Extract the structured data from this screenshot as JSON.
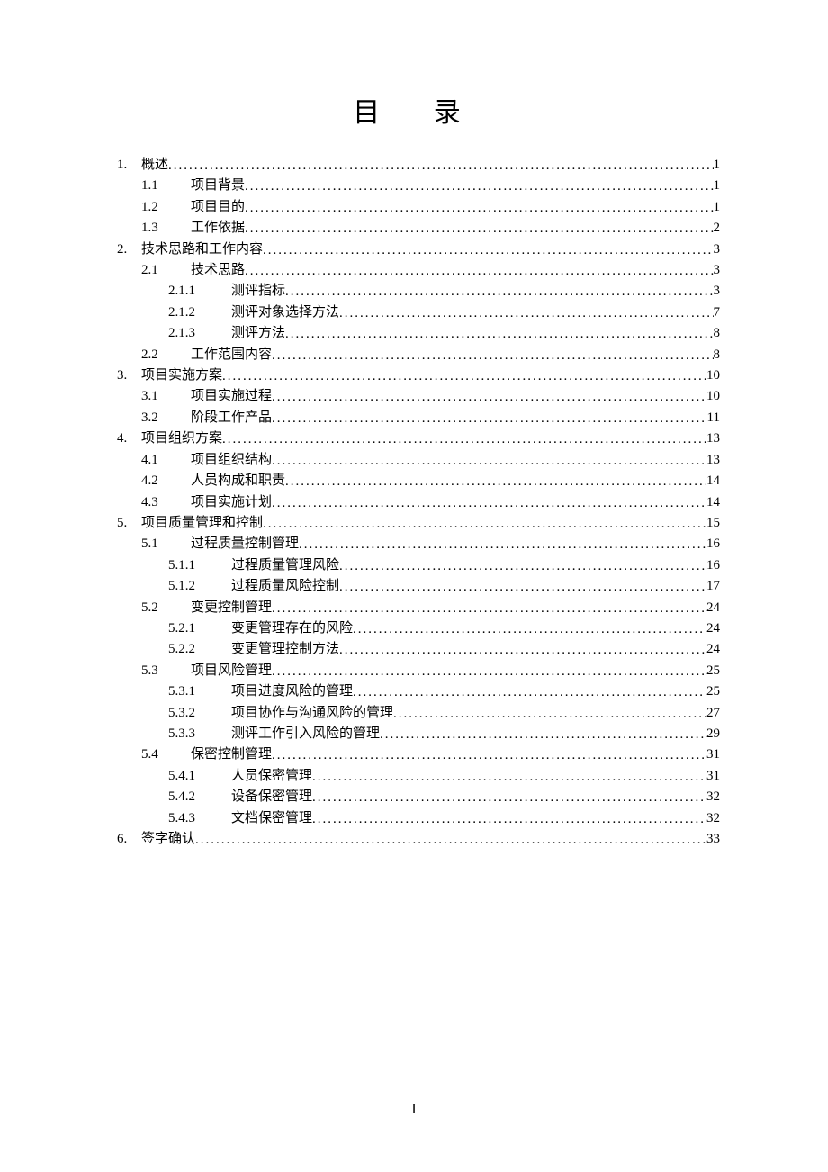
{
  "title": "目 录",
  "page_footer": "I",
  "toc": [
    {
      "level": 1,
      "num": "1.",
      "title": "概述",
      "page": "1"
    },
    {
      "level": 2,
      "num": "1.1",
      "title": "项目背景",
      "page": "1"
    },
    {
      "level": 2,
      "num": "1.2",
      "title": "项目目的",
      "page": "1"
    },
    {
      "level": 2,
      "num": "1.3",
      "title": "工作依据",
      "page": "2"
    },
    {
      "level": 1,
      "num": "2.",
      "title": "技术思路和工作内容",
      "page": "3"
    },
    {
      "level": 2,
      "num": "2.1",
      "title": "技术思路",
      "page": "3"
    },
    {
      "level": 3,
      "num": "2.1.1",
      "title": "测评指标",
      "page": "3"
    },
    {
      "level": 3,
      "num": "2.1.2",
      "title": "测评对象选择方法",
      "page": "7"
    },
    {
      "level": 3,
      "num": "2.1.3",
      "title": "测评方法",
      "page": "8"
    },
    {
      "level": 2,
      "num": "2.2",
      "title": "工作范围内容",
      "page": "8"
    },
    {
      "level": 1,
      "num": "3.",
      "title": "项目实施方案",
      "page": "10"
    },
    {
      "level": 2,
      "num": "3.1",
      "title": "项目实施过程",
      "page": "10"
    },
    {
      "level": 2,
      "num": "3.2",
      "title": "阶段工作产品",
      "page": "11"
    },
    {
      "level": 1,
      "num": "4.",
      "title": "项目组织方案",
      "page": "13"
    },
    {
      "level": 2,
      "num": "4.1",
      "title": "项目组织结构",
      "page": "13"
    },
    {
      "level": 2,
      "num": "4.2",
      "title": "人员构成和职责",
      "page": "14"
    },
    {
      "level": 2,
      "num": "4.3",
      "title": "项目实施计划",
      "page": "14"
    },
    {
      "level": 1,
      "num": "5.",
      "title": "项目质量管理和控制",
      "page": "15"
    },
    {
      "level": 2,
      "num": "5.1",
      "title": "过程质量控制管理",
      "page": "16"
    },
    {
      "level": 3,
      "num": "5.1.1",
      "title": "过程质量管理风险",
      "page": "16"
    },
    {
      "level": 3,
      "num": "5.1.2",
      "title": "过程质量风险控制",
      "page": "17"
    },
    {
      "level": 2,
      "num": "5.2",
      "title": "变更控制管理",
      "page": "24"
    },
    {
      "level": 3,
      "num": "5.2.1",
      "title": "变更管理存在的风险",
      "page": "24"
    },
    {
      "level": 3,
      "num": "5.2.2",
      "title": "变更管理控制方法",
      "page": "24"
    },
    {
      "level": 2,
      "num": "5.3",
      "title": "项目风险管理",
      "page": "25"
    },
    {
      "level": 3,
      "num": "5.3.1",
      "title": "项目进度风险的管理",
      "page": "25"
    },
    {
      "level": 3,
      "num": "5.3.2",
      "title": "项目协作与沟通风险的管理",
      "page": "27"
    },
    {
      "level": 3,
      "num": "5.3.3",
      "title": "测评工作引入风险的管理",
      "page": "29"
    },
    {
      "level": 2,
      "num": "5.4",
      "title": "保密控制管理",
      "page": "31"
    },
    {
      "level": 3,
      "num": "5.4.1",
      "title": "人员保密管理",
      "page": "31"
    },
    {
      "level": 3,
      "num": "5.4.2",
      "title": "设备保密管理",
      "page": "32"
    },
    {
      "level": 3,
      "num": "5.4.3",
      "title": "文档保密管理",
      "page": "32"
    },
    {
      "level": 1,
      "num": "6.",
      "title": "签字确认",
      "page": "33"
    }
  ]
}
